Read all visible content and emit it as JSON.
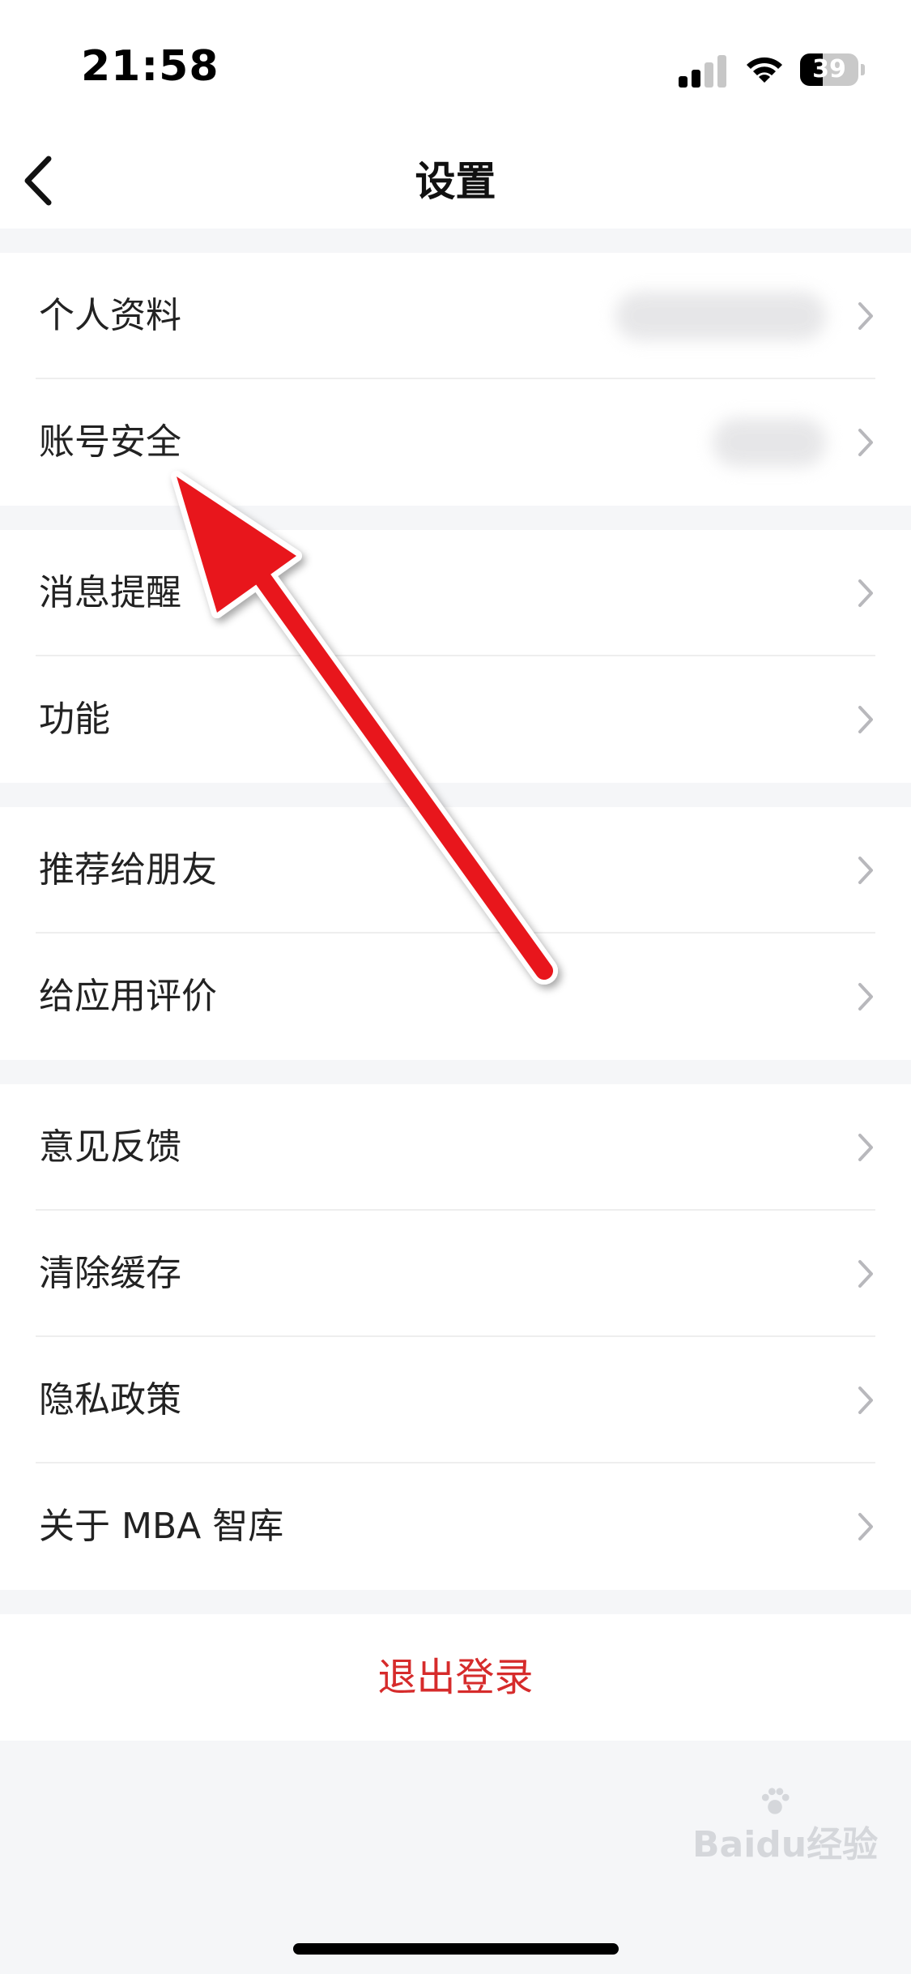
{
  "status_bar": {
    "time": "21:58",
    "battery_level": "39",
    "icons": [
      "cellular-signal-icon",
      "wifi-icon",
      "battery-icon"
    ]
  },
  "nav": {
    "title": "设置",
    "back_icon": "chevron-left-icon"
  },
  "groups": [
    {
      "items": [
        {
          "label": "个人资料",
          "has_blurred_value": true
        },
        {
          "label": "账号安全",
          "has_blurred_value": true
        }
      ]
    },
    {
      "items": [
        {
          "label": "消息提醒"
        },
        {
          "label": "功能"
        }
      ]
    },
    {
      "items": [
        {
          "label": "推荐给朋友"
        },
        {
          "label": "给应用评价"
        }
      ]
    },
    {
      "items": [
        {
          "label": "意见反馈"
        },
        {
          "label": "清除缓存"
        },
        {
          "label": "隐私政策"
        },
        {
          "label": "关于 MBA 智库"
        }
      ]
    }
  ],
  "logout": {
    "label": "退出登录",
    "color": "#d62b2b"
  },
  "annotation": {
    "type": "arrow",
    "color": "#e8141b",
    "points_to": "账号安全"
  },
  "watermark": {
    "text": "Baidu经验"
  },
  "colors": {
    "background": "#f5f6f8",
    "surface": "#ffffff",
    "chevron": "#b8b8bc"
  }
}
